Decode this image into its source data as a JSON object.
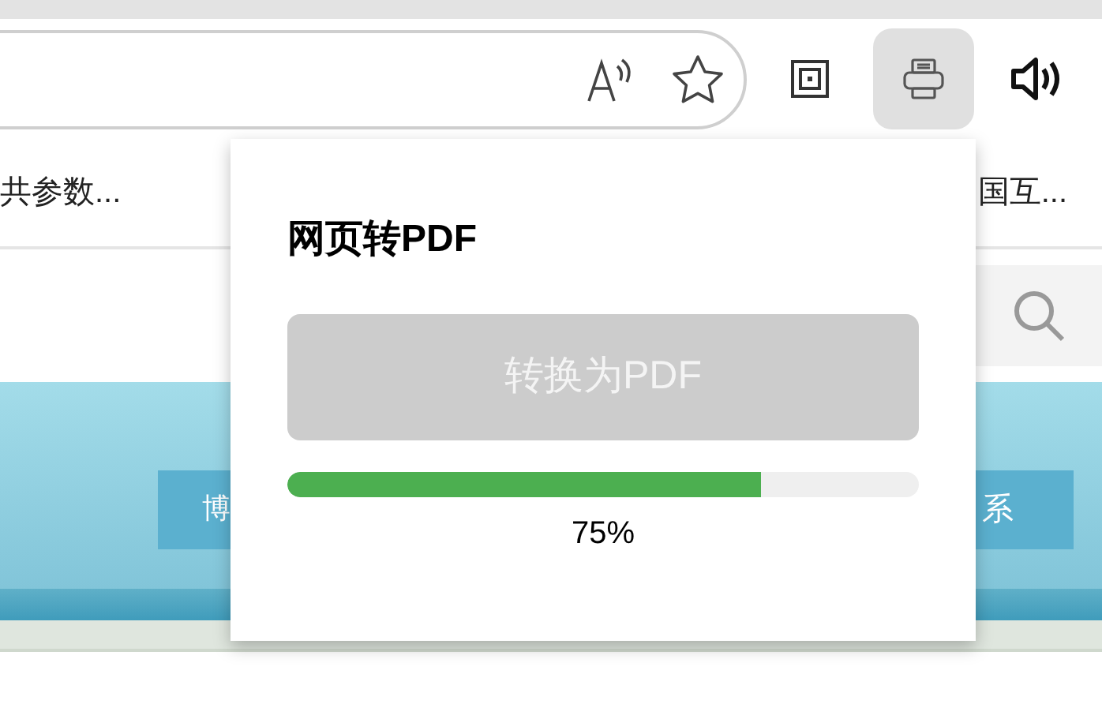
{
  "favorites_bar": {
    "items": [
      {
        "label": "共参数..."
      },
      {
        "label": "国互..."
      }
    ]
  },
  "page": {
    "nav": [
      {
        "label": "博"
      },
      {
        "label": "系"
      }
    ]
  },
  "popup": {
    "title": "网页转PDF",
    "button": {
      "label": "转换为PDF",
      "disabled": true
    },
    "progress": {
      "level": 0.75,
      "reading": "75%"
    }
  },
  "toolbar": {
    "pdf_button": {
      "selected": true
    }
  }
}
